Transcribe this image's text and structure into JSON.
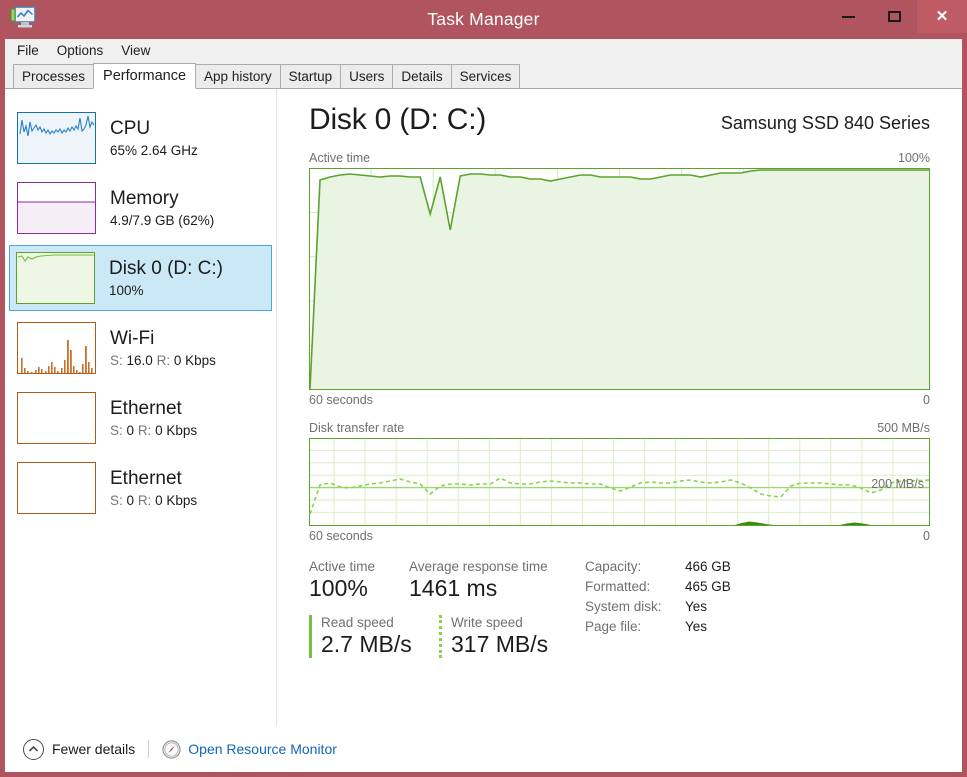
{
  "window": {
    "title": "Task Manager",
    "icon": "task-manager-icon",
    "minimize_label": "–",
    "maximize_label": "□",
    "close_label": "✕",
    "frame_color": "#b0545f"
  },
  "menu": {
    "items": [
      "File",
      "Options",
      "View"
    ]
  },
  "tabs": [
    {
      "label": "Processes",
      "active": false
    },
    {
      "label": "Performance",
      "active": true
    },
    {
      "label": "App history",
      "active": false
    },
    {
      "label": "Startup",
      "active": false
    },
    {
      "label": "Users",
      "active": false
    },
    {
      "label": "Details",
      "active": false
    },
    {
      "label": "Services",
      "active": false
    }
  ],
  "sidebar": {
    "items": [
      {
        "name": "CPU",
        "sub": "65% 2.64 GHz",
        "selected": false,
        "color": "#1a6fa8"
      },
      {
        "name": "Memory",
        "sub": "4.9/7.9 GB (62%)",
        "selected": false,
        "color": "#8b2ba0"
      },
      {
        "name": "Disk 0 (D: C:)",
        "sub": "100%",
        "selected": true,
        "color": "#5ba32b"
      },
      {
        "name": "Wi-Fi",
        "sub_s_label": "S:",
        "sub_s_value": "16.0",
        "sub_r_label": "R:",
        "sub_r_value": "0 Kbps",
        "selected": false,
        "color": "#b35c18"
      },
      {
        "name": "Ethernet",
        "sub_s_label": "S:",
        "sub_s_value": "0",
        "sub_r_label": "R:",
        "sub_r_value": "0 Kbps",
        "selected": false,
        "color": "#b35c18"
      },
      {
        "name": "Ethernet",
        "sub_s_label": "S:",
        "sub_s_value": "0",
        "sub_r_label": "R:",
        "sub_r_value": "0 Kbps",
        "selected": false,
        "color": "#b35c18"
      }
    ]
  },
  "main": {
    "title": "Disk 0 (D: C:)",
    "device": "Samsung SSD 840 Series",
    "active_chart": {
      "label": "Active time",
      "max_label": "100%",
      "time_label": "60 seconds",
      "min_label": "0"
    },
    "rate_chart": {
      "label": "Disk transfer rate",
      "max_label": "500 MB/s",
      "time_label": "60 seconds",
      "min_label": "0",
      "annotation": "200 MB/s"
    },
    "stats": {
      "active_time_label": "Active time",
      "active_time_value": "100%",
      "avg_response_label": "Average response time",
      "avg_response_value": "1461 ms",
      "read_label": "Read speed",
      "read_value": "2.7 MB/s",
      "write_label": "Write speed",
      "write_value": "317 MB/s"
    },
    "info": [
      {
        "label": "Capacity:",
        "value": "466 GB"
      },
      {
        "label": "Formatted:",
        "value": "465 GB"
      },
      {
        "label": "System disk:",
        "value": "Yes"
      },
      {
        "label": "Page file:",
        "value": "Yes"
      }
    ]
  },
  "footer": {
    "fewer_details": "Fewer details",
    "fewer_icon": "chevron-up-circle-icon",
    "resource_monitor": "Open Resource Monitor",
    "resource_monitor_icon": "resource-monitor-icon",
    "link_color": "#1266b8"
  },
  "chart_data": {
    "type": "area",
    "title": "Disk 0 (D: C:) performance",
    "charts": [
      {
        "name": "Active time",
        "type": "area",
        "ylabel": "Active time",
        "ylim": [
          0,
          100
        ],
        "xlabel": "60 seconds",
        "grid": true,
        "line_color": "#5ba32b",
        "fill_color": "#eaf4e2",
        "values": [
          0,
          96,
          97,
          98,
          98,
          97,
          97,
          96,
          97,
          97,
          96,
          96,
          80,
          96,
          74,
          97,
          98,
          98,
          97,
          97,
          96,
          96,
          95,
          95,
          94,
          95,
          96,
          97,
          97,
          96,
          96,
          96,
          96,
          95,
          95,
          96,
          97,
          97,
          97,
          96,
          97,
          98,
          98,
          98,
          99,
          100,
          100,
          100,
          100,
          100,
          100,
          100,
          100,
          100,
          100,
          100,
          100,
          100,
          100,
          100
        ]
      },
      {
        "name": "Disk transfer rate",
        "type": "line",
        "ylabel": "Disk transfer rate",
        "ylim": [
          0,
          500
        ],
        "xlabel": "60 seconds",
        "grid": true,
        "annotation": "200 MB/s",
        "series": [
          {
            "name": "Read (dashed)",
            "color": "#8ad44b",
            "style": "dashed",
            "values": [
              60,
              230,
              240,
              215,
              212,
              225,
              232,
              240,
              250,
              262,
              245,
              232,
              180,
              225,
              235,
              232,
              230,
              232,
              235,
              268,
              240,
              235,
              237,
              245,
              250,
              245,
              240,
              238,
              235,
              232,
              210,
              196,
              218,
              240,
              243,
              240,
              236,
              250,
              255,
              242,
              238,
              245,
              252,
              240,
              215,
              180,
              168,
              165,
              222,
              238,
              240,
              236,
              235,
              230,
              228,
              212,
              186,
              200,
              240,
              250
            ]
          },
          {
            "name": "Write (solid)",
            "color": "#3d8c0a",
            "style": "solid",
            "values": [
              0,
              0,
              0,
              0,
              0,
              0,
              0,
              0,
              0,
              0,
              0,
              0,
              0,
              0,
              0,
              0,
              0,
              0,
              0,
              0,
              0,
              0,
              0,
              0,
              0,
              0,
              0,
              0,
              0,
              0,
              0,
              0,
              0,
              0,
              0,
              0,
              0,
              0,
              0,
              0,
              0,
              0,
              0,
              10,
              14,
              10,
              0,
              0,
              0,
              0,
              0,
              0,
              0,
              0,
              8,
              12,
              8,
              0,
              0,
              0
            ]
          }
        ]
      }
    ],
    "thumbnails": [
      {
        "name": "CPU",
        "type": "line",
        "color": "#1a6fa8",
        "values": [
          55,
          90,
          60,
          75,
          52,
          88,
          70,
          66,
          78,
          62,
          70,
          58,
          64,
          60,
          66,
          58,
          62,
          55,
          60,
          58,
          62,
          57,
          64,
          58,
          70,
          60,
          68,
          62,
          72,
          60,
          66,
          58,
          90,
          60,
          62,
          72,
          95,
          70,
          80,
          74
        ]
      },
      {
        "name": "Memory",
        "type": "area",
        "color": "#8b2ba0",
        "values": [
          62
        ]
      },
      {
        "name": "Disk 0 (D: C:)",
        "type": "area",
        "color": "#5ba32b",
        "values": [
          95,
          80,
          88,
          92,
          96,
          94,
          96,
          97,
          97,
          98,
          98,
          99,
          100,
          100,
          100,
          100,
          100,
          100,
          100,
          100
        ]
      },
      {
        "name": "Wi-Fi",
        "type": "spike",
        "color": "#b35c18",
        "values": [
          22,
          6,
          2,
          1,
          0,
          0,
          3,
          7,
          4,
          2,
          0,
          1,
          5,
          9,
          14,
          8,
          3,
          1,
          0,
          2,
          10,
          5,
          2,
          0,
          4,
          18,
          48,
          80,
          40,
          12,
          5,
          2,
          0,
          6,
          30,
          58,
          26,
          10,
          14,
          6
        ]
      },
      {
        "name": "Ethernet",
        "type": "empty",
        "color": "#b35c18",
        "values": []
      },
      {
        "name": "Ethernet",
        "type": "empty",
        "color": "#b35c18",
        "values": []
      }
    ]
  }
}
